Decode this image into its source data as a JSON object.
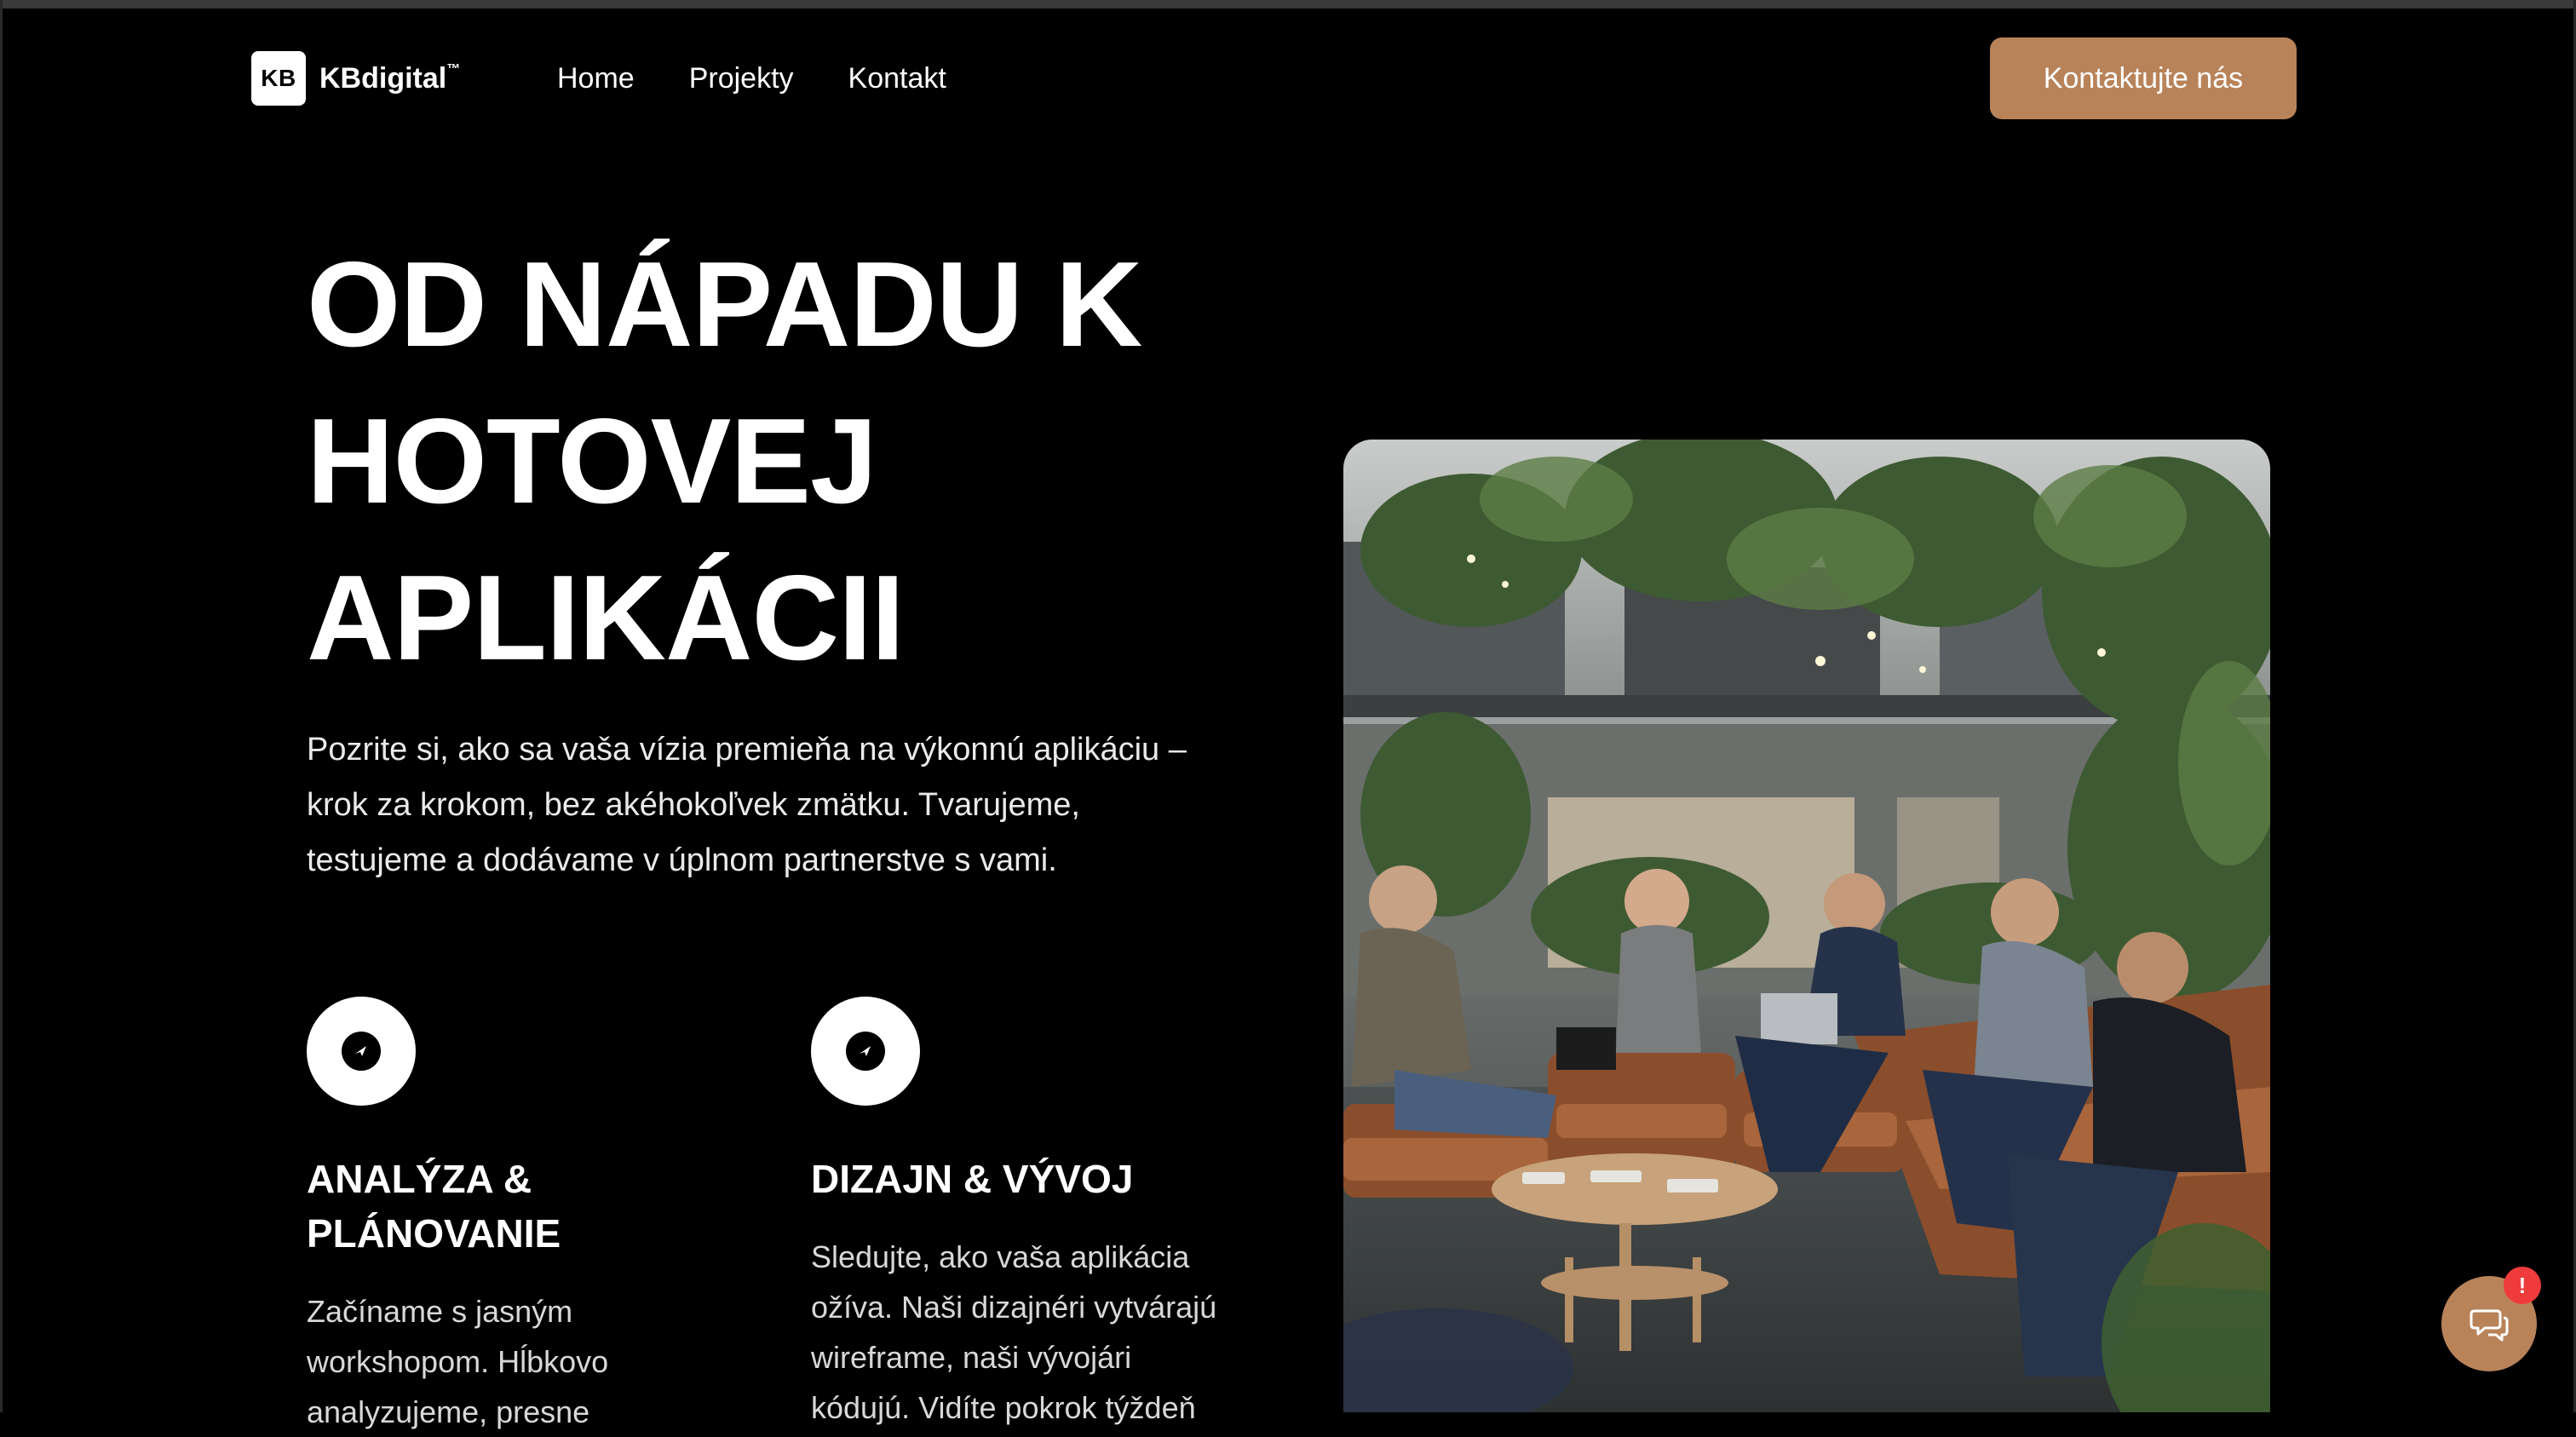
{
  "brand": {
    "mark": "KB",
    "name": "KBdigital",
    "trademark": "™"
  },
  "nav": {
    "items": [
      {
        "label": "Home"
      },
      {
        "label": "Projekty"
      },
      {
        "label": "Kontakt"
      }
    ]
  },
  "cta": {
    "label": "Kontaktujte nás"
  },
  "hero": {
    "title_lines": [
      "OD NÁPADU K",
      "HOTOVEJ",
      "APLIKÁCII"
    ],
    "subtitle_lines": [
      "Pozrite si, ako sa vaša vízia premieňa na výkonnú aplikáciu –",
      "krok za krokom, bez akéhokoľvek zmätku. Tvarujeme,",
      "testujeme a dodávame v úplnom partnerstve s vami."
    ]
  },
  "features": [
    {
      "icon": "compass-icon",
      "title_lines": [
        "ANALÝZA &",
        "PLÁNOVANIE"
      ],
      "text_lines": [
        "Začíname s jasným",
        "workshopom. Hĺbkovo",
        "analyzujeme, presne"
      ]
    },
    {
      "icon": "compass-icon",
      "title_lines": [
        "DIZAJN & VÝVOJ"
      ],
      "text_lines": [
        "Sledujte, ako vaša aplikácia",
        "ožíva. Naši dizajnéri vytvárajú",
        "wireframe, naši vývojári",
        "kódujú. Vidíte pokrok týždeň"
      ]
    }
  ],
  "chat": {
    "icon": "chat-icon",
    "badge": "!"
  },
  "colors": {
    "accent": "#b9835a",
    "background": "#000000",
    "badge": "#ef3b3b"
  }
}
